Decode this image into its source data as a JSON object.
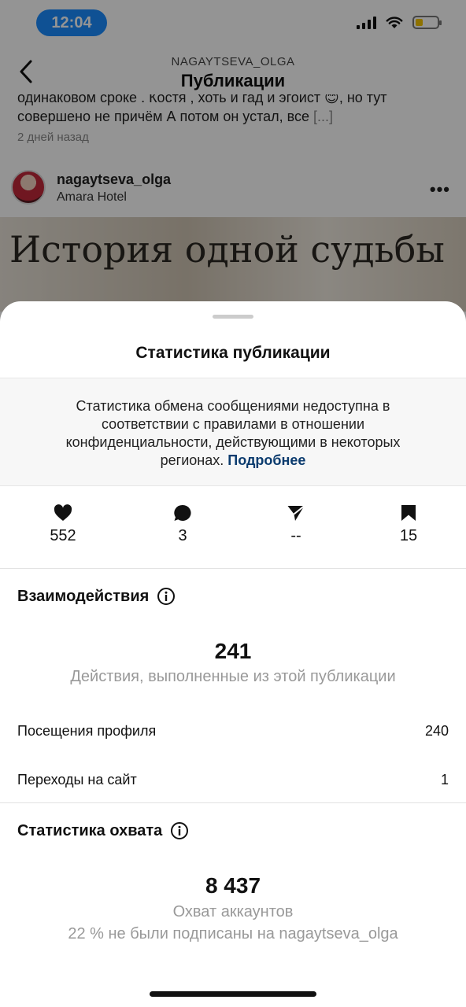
{
  "status_bar": {
    "time": "12:04",
    "time_pill_color": "#1a8cff",
    "battery_color": "#f5c400",
    "battery_level": 0.35
  },
  "nav": {
    "subtitle": "NAGAYTSEVA_OLGA",
    "title": "Публикации"
  },
  "caption": {
    "text": "одинаковом сроке . Костя , хоть и гад и эгоист 😊, но тут совершено не причём А потом он устал, все",
    "more": "[...]",
    "time_ago": "2 дней назад"
  },
  "post": {
    "username": "nagaytseva_olga",
    "location": "Amara Hotel",
    "image_title": "История одной судьбы"
  },
  "sheet": {
    "title": "Статистика публикации",
    "notice_text": "Статистика обмена сообщениями недоступна в соответствии с правилами в отношении конфиденциальности, действующими в некоторых регионах.",
    "notice_link": "Подробнее",
    "metrics": [
      {
        "icon": "heart-icon",
        "value": "552"
      },
      {
        "icon": "comment-icon",
        "value": "3"
      },
      {
        "icon": "share-icon",
        "value": "--"
      },
      {
        "icon": "bookmark-icon",
        "value": "15"
      }
    ],
    "interactions": {
      "title": "Взаимодействия",
      "total": "241",
      "description": "Действия, выполненные из этой публикации",
      "rows": [
        {
          "label": "Посещения профиля",
          "value": "240"
        },
        {
          "label": "Переходы на сайт",
          "value": "1"
        }
      ]
    },
    "reach": {
      "title": "Статистика охвата",
      "total": "8 437",
      "description": "Охват аккаунтов",
      "note": "22 % не были подписаны на nagaytseva_olga"
    }
  }
}
